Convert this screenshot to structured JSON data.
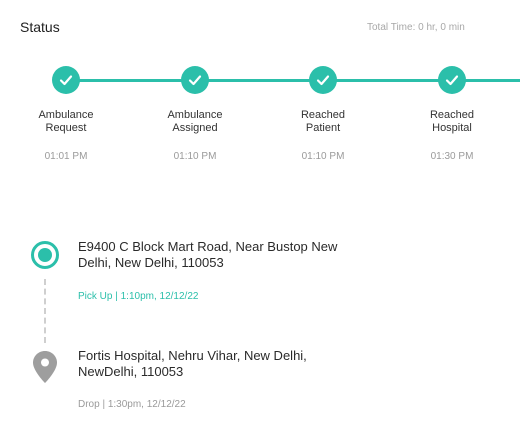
{
  "header": {
    "title": "Status",
    "total_time": "Total Time: 0 hr, 0 min"
  },
  "colors": {
    "accent": "#2bbfaa",
    "muted": "#9a9a9a",
    "pin": "#9e9e9e"
  },
  "steps": [
    {
      "label_line1": "Ambulance",
      "label_line2": "Request",
      "time": "01:01 PM",
      "icon": "check-icon"
    },
    {
      "label_line1": "Ambulance",
      "label_line2": "Assigned",
      "time": "01:10 PM",
      "icon": "check-icon"
    },
    {
      "label_line1": "Reached",
      "label_line2": "Patient",
      "time": "01:10 PM",
      "icon": "check-icon"
    },
    {
      "label_line1": "Reached",
      "label_line2": "Hospital",
      "time": "01:30 PM",
      "icon": "check-icon"
    }
  ],
  "pickup": {
    "address_line1": "E9400 C Block Mart Road, Near Bustop New",
    "address_line2": "Delhi, New Delhi, 110053",
    "meta": "Pick Up | 1:10pm, 12/12/22",
    "icon": "pickup-location-icon"
  },
  "drop": {
    "address_line1": "Fortis Hospital, Nehru Vihar, New Delhi,",
    "address_line2": "NewDelhi, 110053",
    "meta": "Drop | 1:30pm, 12/12/22",
    "icon": "map-pin-icon"
  }
}
